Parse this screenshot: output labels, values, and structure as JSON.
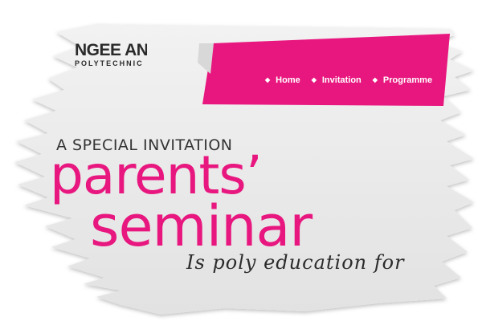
{
  "logo": {
    "line1": "NGEE ANN",
    "line2": "POLYTECHNIC"
  },
  "nav": {
    "items": [
      {
        "label": "Home"
      },
      {
        "label": "Invitation"
      },
      {
        "label": "Programme"
      }
    ]
  },
  "hero": {
    "invite_text": "A SPECIAL INVITATION",
    "title_line1": "parents’",
    "title_line2": "seminar",
    "tagline": "Is poly education for"
  },
  "colors": {
    "accent": "#e8177f",
    "brush": "#ededed",
    "text_dark": "#333333"
  }
}
